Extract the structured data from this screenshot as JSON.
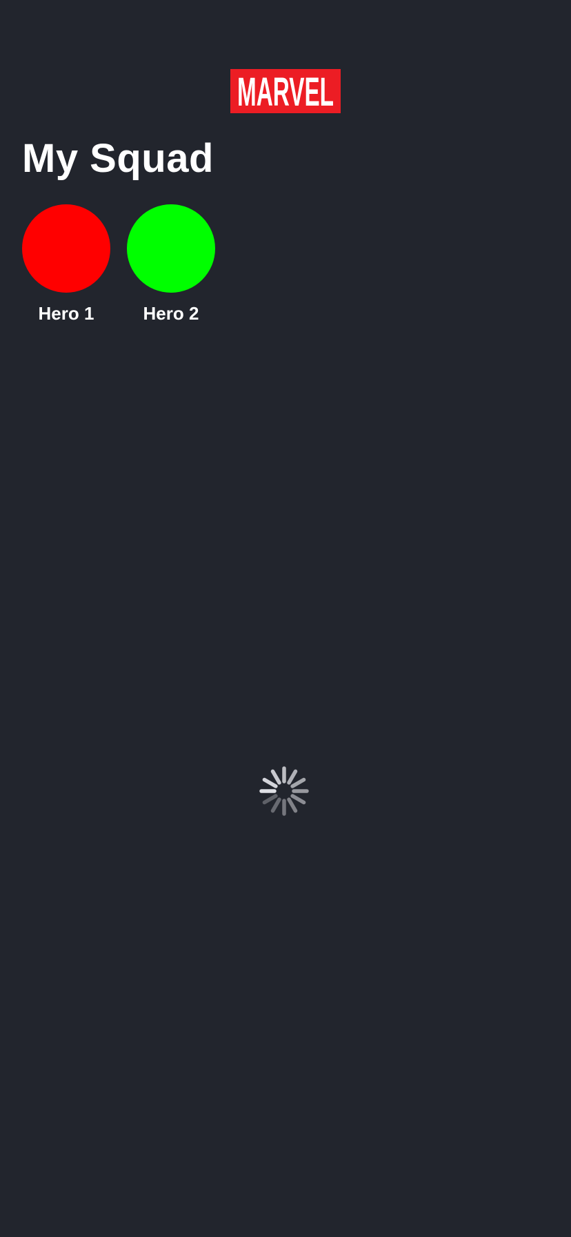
{
  "header": {
    "logo_text": "MARVEL",
    "logo_color": "#ec1d24"
  },
  "page_title": "My Squad",
  "squad": {
    "heroes": [
      {
        "name": "Hero 1",
        "color": "#ff0000"
      },
      {
        "name": "Hero 2",
        "color": "#00ff00"
      }
    ]
  },
  "loading_indicator": {
    "icon": "activity-spinner-icon"
  },
  "colors": {
    "background": "#22252d",
    "text": "#ffffff"
  }
}
